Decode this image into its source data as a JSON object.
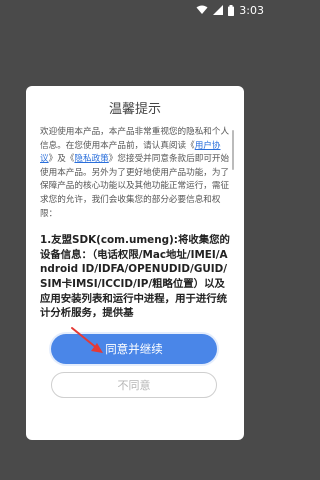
{
  "status_bar": {
    "time": "3:03",
    "icons": [
      "wifi-icon",
      "signal-icon",
      "battery-icon"
    ]
  },
  "dialog": {
    "title": "温馨提示",
    "intro_part1": "欢迎使用本产品，本产品非常重视您的隐私和个人信息。在您使用本产品前，请认真阅读《",
    "user_agreement_link": "用户协议",
    "intro_part2": "》及《",
    "privacy_policy_link": "隐私政策",
    "intro_part3": "》您接受并同意条款后即可开始使用本产品。另外为了更好地使用产品功能，为了保障产品的核心功能以及其他功能正常运行，需征求您的允许，我们会收集您的部分必要信息和权限：",
    "section_1": "1.友盟SDK(com.umeng):将收集您的设备信息：（电话权限/Mac地址/IMEI/Android ID/IDFA/OPENUDID/GUID/SIM卡IMSI/ICCID/IP/粗略位置）以及应用安装列表和运行中进程，用于进行统计分析服务，提供基"
  },
  "buttons": {
    "agree": "同意并继续",
    "disagree": "不同意"
  },
  "colors": {
    "accent": "#4a86e8",
    "link": "#2a6fdb",
    "annotation_arrow": "#e53935",
    "overlay": "#4a4a4a"
  }
}
